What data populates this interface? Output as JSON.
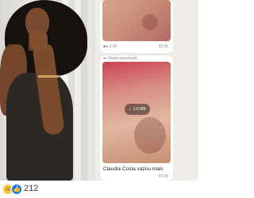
{
  "post_photo": {
    "alt_subject": ""
  },
  "chat": {
    "messages": [
      {
        "type": "image",
        "duration": "0:03",
        "time": "20:36"
      },
      {
        "type": "video",
        "forwarded_label": "Reencaminhada",
        "download_size": "1.6 MB",
        "caption": "Claudia Costa vazou mais",
        "time": "20:36"
      }
    ]
  },
  "reactions": {
    "icons": [
      "haha-icon",
      "like-icon"
    ],
    "count": "212",
    "colors": {
      "like": "#1877f2",
      "haha": "#f6c63d"
    }
  }
}
